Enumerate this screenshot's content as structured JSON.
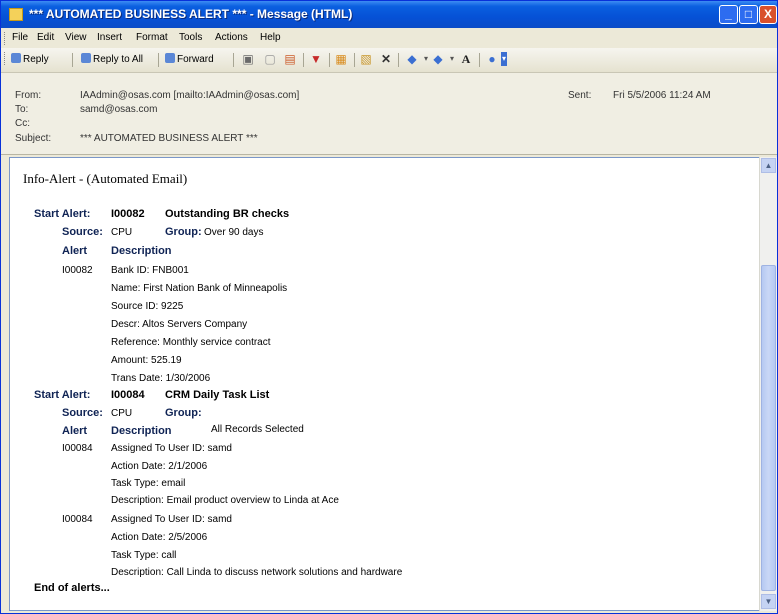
{
  "window": {
    "title": "*** AUTOMATED BUSINESS ALERT *** - Message (HTML)",
    "min": "_",
    "max": "□",
    "close": "X"
  },
  "menu": [
    "File",
    "Edit",
    "View",
    "Insert",
    "Format",
    "Tools",
    "Actions",
    "Help"
  ],
  "toolbar": {
    "reply": "Reply",
    "reply_all": "Reply to All",
    "forward": "Forward"
  },
  "header": {
    "from_label": "From:",
    "from_value": "IAAdmin@osas.com [mailto:IAAdmin@osas.com]",
    "to_label": "To:",
    "to_value": "samd@osas.com",
    "cc_label": "Cc:",
    "cc_value": "",
    "subject_label": "Subject:",
    "subject_value": "*** AUTOMATED BUSINESS ALERT ***",
    "sent_label": "Sent:",
    "sent_value": "Fri 5/5/2006 11:24 AM"
  },
  "body": {
    "intro": "Info-Alert - (Automated Email)",
    "alerts": [
      {
        "start_label": "Start Alert:",
        "code": "I00082",
        "name": "Outstanding BR checks",
        "source_label": "Source:",
        "source": "CPU",
        "group_label": "Group:",
        "group": "Over 90 days",
        "col_alert": "Alert",
        "col_desc": "Description",
        "col_extra": "",
        "rows": [
          {
            "alert": "I00082",
            "lines": [
              "Bank ID: FNB001",
              "Name: First Nation Bank of Minneapolis",
              "Source ID: 9225",
              "Descr: Altos Servers Company",
              "Reference: Monthly service contract",
              "Amount: 525.19",
              "Trans Date: 1/30/2006"
            ]
          }
        ]
      },
      {
        "start_label": "Start Alert:",
        "code": "I00084",
        "name": "CRM Daily Task List",
        "source_label": "Source:",
        "source": "CPU",
        "group_label": "Group:",
        "group": "",
        "col_alert": "Alert",
        "col_desc": "Description",
        "col_extra": "All Records Selected",
        "rows": [
          {
            "alert": "I00084",
            "lines": [
              "Assigned To User ID: samd",
              "Action Date: 2/1/2006",
              "Task Type: email",
              "Description: Email product overview to Linda at Ace"
            ]
          },
          {
            "alert": "I00084",
            "lines": [
              "Assigned To User ID: samd",
              "Action Date: 2/5/2006",
              "Task Type: call",
              "Description: Call Linda to discuss network solutions and hardware"
            ]
          }
        ]
      }
    ],
    "end": "End of alerts..."
  },
  "colors": {
    "titlebar": "#0651d6",
    "heading": "#0f2354",
    "header_bg": "#f0eee3"
  }
}
